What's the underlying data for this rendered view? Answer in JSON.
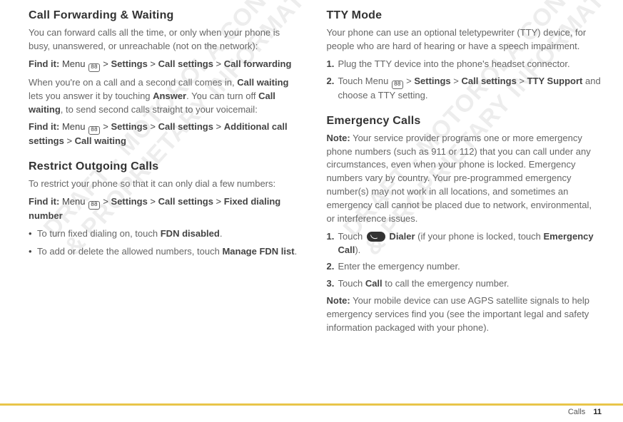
{
  "watermark": "DRAFT - MOTOROLA CONFIDENTIAL\n& PROPRIETARY INFORMATION",
  "left": {
    "sec1": {
      "heading": "Call Forwarding & Waiting",
      "p1": "You can forward calls all the time, or only when your phone is busy, unanswered, or unreachable (not on the network):",
      "find1_a": "Find it:",
      "find1_b": " Menu ",
      "find1_c": " > ",
      "find1_d": "Settings",
      "find1_e": " > ",
      "find1_f": "Call settings",
      "find1_g": " > ",
      "find1_h": "Call forwarding",
      "p2a": "When you're on a call and a second call comes in, ",
      "p2b": "Call waiting",
      "p2c": " lets you answer it by touching ",
      "p2d": "Answer",
      "p2e": ". You can turn off ",
      "p2f": "Call waiting",
      "p2g": ", to send second calls straight to your voicemail:",
      "find2_a": "Find it:",
      "find2_b": " Menu ",
      "find2_c": " > ",
      "find2_d": "Settings",
      "find2_e": " > ",
      "find2_f": "Call settings",
      "find2_g": " > ",
      "find2_h": "Additional call settings",
      "find2_i": " > ",
      "find2_j": "Call waiting"
    },
    "sec2": {
      "heading": "Restrict Outgoing Calls",
      "p1": "To restrict your phone so that it can only dial a few numbers:",
      "find_a": "Find it:",
      "find_b": " Menu ",
      "find_c": " > ",
      "find_d": "Settings",
      "find_e": " > ",
      "find_f": "Call settings",
      "find_g": " > ",
      "find_h": "Fixed dialing number",
      "b1a": "To turn fixed dialing on, touch ",
      "b1b": "FDN disabled",
      "b1c": ".",
      "b2a": "To add or delete the allowed numbers, touch ",
      "b2b": "Manage FDN list",
      "b2c": "."
    }
  },
  "right": {
    "sec1": {
      "heading": "TTY Mode",
      "p1": "Your phone can use an optional teletypewriter (TTY) device, for people who are hard of hearing or have a speech impairment.",
      "s1": "Plug the TTY device into the phone's headset connector.",
      "s2a": "Touch Menu ",
      "s2b": " > ",
      "s2c": "Settings",
      "s2d": " > ",
      "s2e": "Call settings",
      "s2f": " > ",
      "s2g": "TTY Support",
      "s2h": " and choose a TTY setting."
    },
    "sec2": {
      "heading": "Emergency Calls",
      "note_label": "Note:",
      "note_body": " Your service provider programs one or more emergency phone numbers (such as 911 or 112) that you can call under any circumstances, even when your phone is locked. Emergency numbers vary by country. Your pre-programmed emergency number(s) may not work in all locations, and sometimes an emergency call cannot be placed due to network, environmental, or interference issues.",
      "s1a": "Touch ",
      "s1b": " Dialer",
      "s1c": " (if your phone is locked, touch ",
      "s1d": "Emergency Call",
      "s1e": ").",
      "s2": "Enter the emergency number.",
      "s3a": "Touch ",
      "s3b": "Call",
      "s3c": " to call the emergency number.",
      "note2_label": "Note:",
      "note2_body": " Your mobile device can use AGPS satellite signals to help emergency services find you (see the important legal and safety information packaged with your phone)."
    }
  },
  "footer": {
    "section": "Calls",
    "page": "11"
  },
  "icons": {
    "menu": "88"
  }
}
